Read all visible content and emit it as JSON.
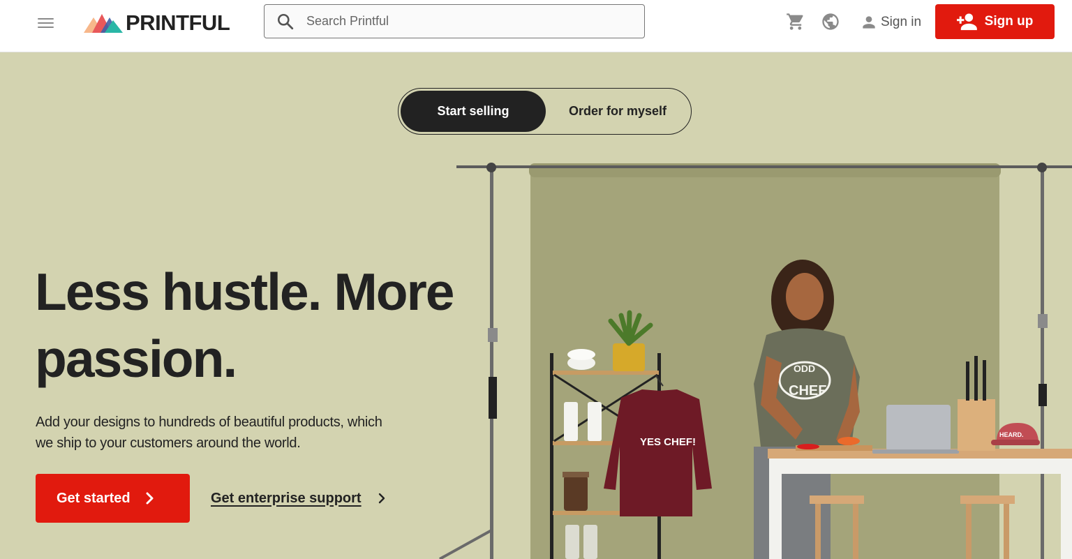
{
  "header": {
    "brand": "PRINTFUL",
    "search_placeholder": "Search Printful",
    "cart_icon": "cart-icon",
    "language_icon": "globe-icon",
    "signin_label": "Sign in",
    "signup_label": "Sign up"
  },
  "toggle": {
    "options": [
      {
        "label": "Start selling",
        "active": true
      },
      {
        "label": "Order for myself",
        "active": false
      }
    ]
  },
  "hero": {
    "headline_line1": "Less hustle. More",
    "headline_line2": "passion.",
    "subtext": "Add your designs to hundreds of beautiful products, which we ship to your customers around the world.",
    "primary_cta": "Get started",
    "secondary_cta": "Get enterprise support",
    "image": {
      "sweatshirt_text": "YES CHEF!",
      "tshirt_text_1": "ODD",
      "tshirt_text_2": "CHEF",
      "cap_text": "HEARD."
    }
  },
  "colors": {
    "accent": "#e11a0e",
    "hero_bg": "#d3d3b0",
    "backdrop": "#a4a47a",
    "dark": "#222222"
  }
}
